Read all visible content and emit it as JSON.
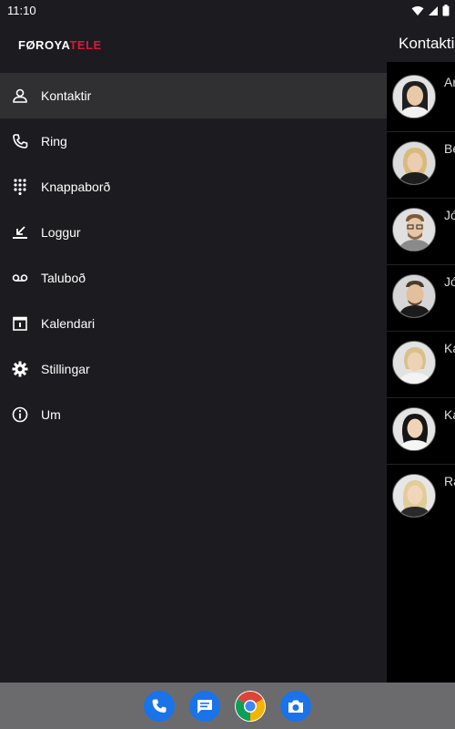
{
  "status": {
    "time": "11:10"
  },
  "brand": {
    "logo_part1": "FØROYA",
    "logo_part2": "TELE",
    "accent_color": "#d9183b"
  },
  "background_app": {
    "title": "Kontakti",
    "contacts": [
      {
        "initial": "Ar"
      },
      {
        "initial": "Be"
      },
      {
        "initial": "Jó"
      },
      {
        "initial": "Jó"
      },
      {
        "initial": "Ka"
      },
      {
        "initial": "Ka"
      },
      {
        "initial": "Ra"
      }
    ]
  },
  "drawer": {
    "items": [
      {
        "label": "Kontaktir",
        "icon": "contact-icon",
        "active": true
      },
      {
        "label": "Ring",
        "icon": "phone-icon"
      },
      {
        "label": "Knappaborð",
        "icon": "dialpad-icon"
      },
      {
        "label": "Loggur",
        "icon": "call-log-icon"
      },
      {
        "label": "Taluboð",
        "icon": "voicemail-icon"
      },
      {
        "label": "Kalendari",
        "icon": "calendar-icon"
      },
      {
        "label": "Stillingar",
        "icon": "gear-icon"
      },
      {
        "label": "Um",
        "icon": "info-icon"
      }
    ]
  },
  "dock": {
    "apps": [
      {
        "name": "phone-app-icon",
        "color": "#1a73e8"
      },
      {
        "name": "messages-app-icon",
        "color": "#1a73e8"
      },
      {
        "name": "chrome-app-icon",
        "color": "#ffffff"
      },
      {
        "name": "camera-app-icon",
        "color": "#1a73e8"
      }
    ]
  }
}
